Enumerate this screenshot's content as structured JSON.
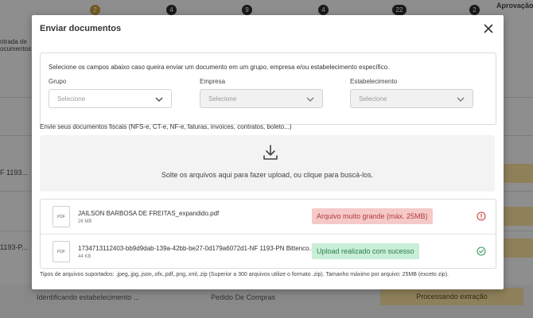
{
  "background": {
    "step_counts": [
      "2",
      "4",
      "9",
      "4",
      "22",
      "2"
    ],
    "step_last_label": "Aprovação",
    "side_label_line1": "ntrada de",
    "side_label_line2": "ocumentos",
    "row_fragment_1": "F 1193...",
    "row_fragment_2": "1193-P...",
    "bottom_row": {
      "col1": "Identificando estabelecimento ...",
      "col2": "Pedido De Compras",
      "status": "Processando extração"
    }
  },
  "modal": {
    "title": "Enviar documentos",
    "filter_instructions": "Selecione os campos abaixo caso queira enviar um documento em um grupo, empresa e/ou estabelecimento específico.",
    "fields": {
      "grupo": {
        "label": "Grupo",
        "placeholder": "Selecione"
      },
      "empresa": {
        "label": "Empresa",
        "placeholder": "Selecione"
      },
      "estabelecimento": {
        "label": "Estabelecimento",
        "placeholder": "Selecione"
      }
    },
    "fiscal_label": "Envie seus documentos fiscais (NFS-e, CT-e, NF-e, faturas, invoices, contratos, boleto...)",
    "dropzone_text": "Solte os arquivos aqui para fazer upload, ou clique para buscá-los.",
    "files": [
      {
        "icon_label": "PDF",
        "name": "JAILSON BARBOSA DE FREITAS_expandido.pdf",
        "size": "26 MB",
        "status": "Arquivo muito grande (máx. 25MB)",
        "status_type": "error"
      },
      {
        "icon_label": "PDF",
        "name": "1734713112403-bb9d9dab-139a-42bb-be27-0d179a6072d1-NF 1193-PN Bittenco...",
        "size": "44 KB",
        "status": "Upload realizado com sucesso",
        "status_type": "success"
      }
    ],
    "supported_text": "Tipos de arquivos suportados: .jpeg,.jpg,.json,.ofx,.pdf,.png,.xml,.zip (Superior a 300 arquivos utilize o formato .zip). Tamanho máximo por arquivo: 25MB (exceto zip)."
  },
  "colors": {
    "error_bg": "#f6c9c9",
    "error_text": "#b03b3b",
    "success_bg": "#c9eed7",
    "success_text": "#2a7f4d",
    "accent_step": "#c79a3d"
  },
  "icons": {
    "close": "close-icon",
    "chevron": "chevron-down-icon",
    "upload": "download-arrow-icon",
    "error": "alert-circle-icon",
    "success": "check-circle-icon"
  }
}
